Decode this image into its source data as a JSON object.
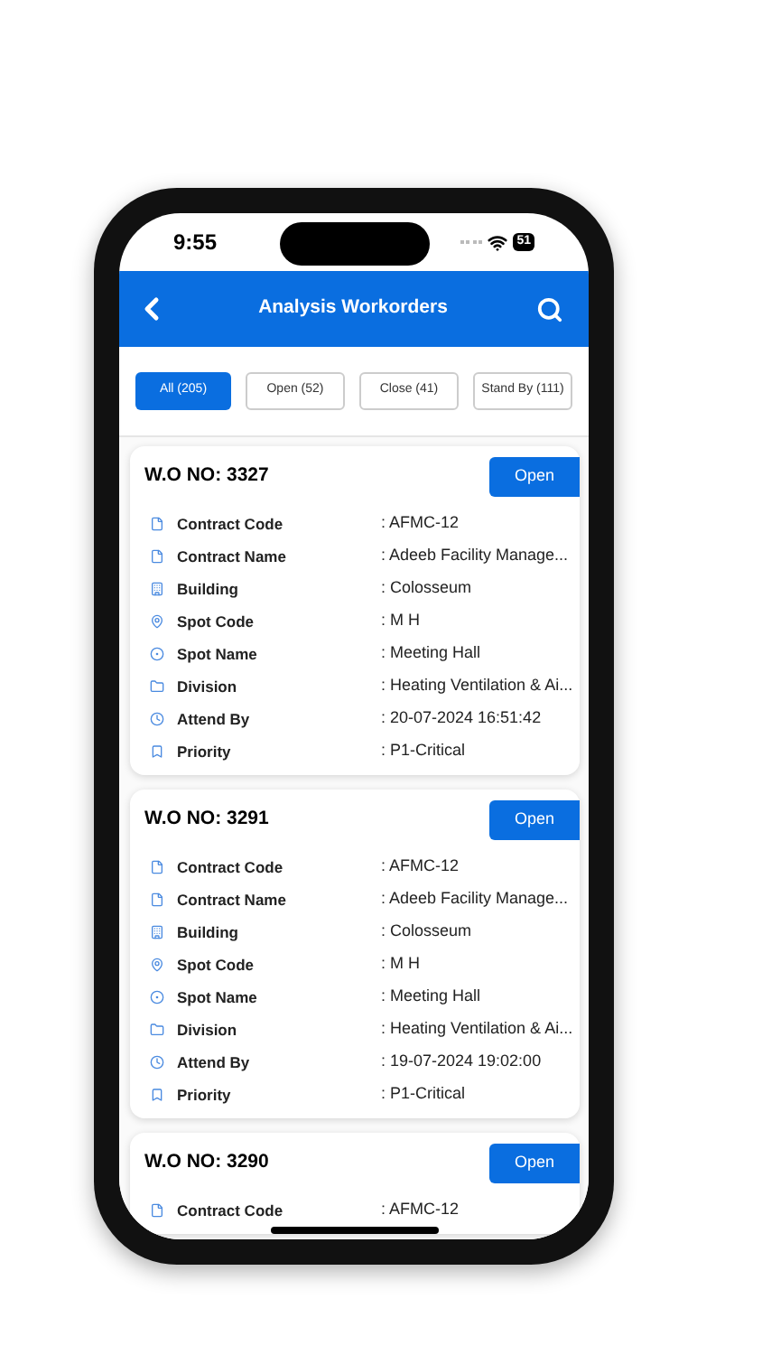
{
  "status_bar": {
    "time": "9:55",
    "battery": "51"
  },
  "header": {
    "title": "Analysis Workorders"
  },
  "tabs": [
    {
      "label": "All (205)",
      "selected": true
    },
    {
      "label": "Open (52)",
      "selected": false
    },
    {
      "label": "Close (41)",
      "selected": false
    },
    {
      "label": "Stand By (111)",
      "selected": false
    }
  ],
  "workorders": [
    {
      "title": "W.O NO: 3327",
      "button": "Open",
      "fields": [
        {
          "label": "Contract Code",
          "value": ": AFMC-12"
        },
        {
          "label": "Contract Name",
          "value": ": Adeeb Facility Manage..."
        },
        {
          "label": "Building",
          "value": ": Colosseum"
        },
        {
          "label": "Spot Code",
          "value": ": M H"
        },
        {
          "label": "Spot Name",
          "value": ": Meeting Hall"
        },
        {
          "label": "Division",
          "value": ": Heating Ventilation & Ai..."
        },
        {
          "label": "Attend By",
          "value": ": 20-07-2024 16:51:42"
        },
        {
          "label": "Priority",
          "value": ": P1-Critical"
        }
      ]
    },
    {
      "title": "W.O NO: 3291",
      "button": "Open",
      "fields": [
        {
          "label": "Contract Code",
          "value": ": AFMC-12"
        },
        {
          "label": "Contract Name",
          "value": ": Adeeb Facility Manage..."
        },
        {
          "label": "Building",
          "value": ": Colosseum"
        },
        {
          "label": "Spot Code",
          "value": ": M H"
        },
        {
          "label": "Spot Name",
          "value": ": Meeting Hall"
        },
        {
          "label": "Division",
          "value": ": Heating Ventilation & Ai..."
        },
        {
          "label": "Attend By",
          "value": ": 19-07-2024 19:02:00"
        },
        {
          "label": "Priority",
          "value": ": P1-Critical"
        }
      ]
    },
    {
      "title": "W.O NO: 3290",
      "button": "Open",
      "fields": [
        {
          "label": "Contract Code",
          "value": ": AFMC-12"
        }
      ]
    }
  ]
}
